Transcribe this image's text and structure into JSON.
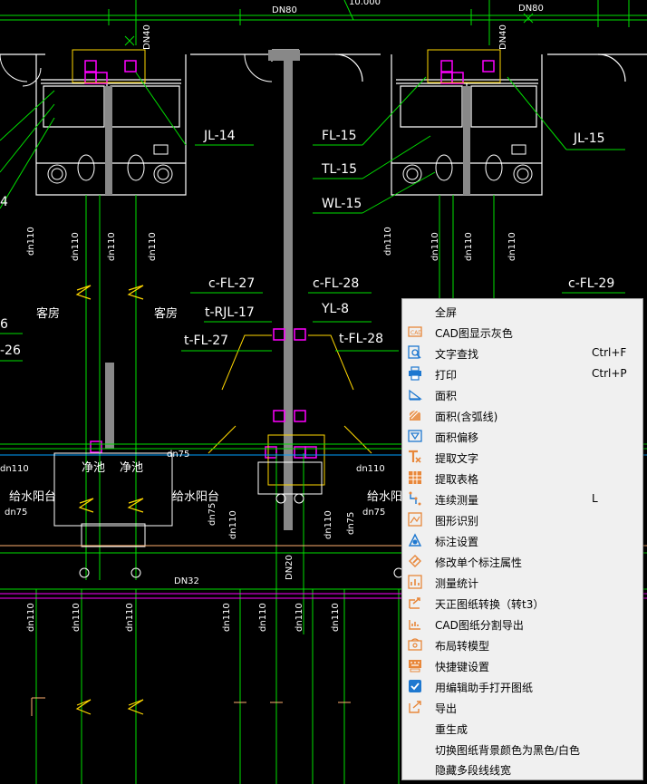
{
  "drawing": {
    "pipe_size_labels": {
      "dn80": "DN80",
      "dn40": "DN40",
      "dn110": "dn110",
      "dn75": "dn75",
      "dn32": "DN32",
      "dn20": "DN20"
    },
    "top_value": "10.000",
    "pipe_labels": {
      "jl14": "JL-14",
      "jl15": "JL-15",
      "fl15": "FL-15",
      "tl15": "TL-15",
      "wl15": "WL-15",
      "fl27": "c-FL-27",
      "fl28a": "c-FL-28",
      "fl29": "c-FL-29",
      "rjl17": "t-RJL-17",
      "yl8": "YL-8",
      "tfl27": "t-FL-27",
      "tfl28": "t-FL-28",
      "num6": "6",
      "num26": "-26",
      "num4": "4"
    },
    "room_labels": {
      "kefang": "客房",
      "jingchi": "净池",
      "shuitai": "给水阳台"
    },
    "colors": {
      "pipe_green": "#00e000",
      "wall_white": "#ffffff",
      "fixture_magenta": "#ff00ff",
      "pipe_yellow": "#ffd700",
      "pipe_orange": "#ffb070",
      "column_gray": "#888888"
    }
  },
  "context_menu": {
    "items": [
      {
        "label": "全屏",
        "shortcut": "",
        "icon": "none"
      },
      {
        "label": "CAD图显示灰色",
        "shortcut": "",
        "icon": "cad-gray-icon"
      },
      {
        "label": "文字查找",
        "shortcut": "Ctrl+F",
        "icon": "text-search-icon"
      },
      {
        "label": "打印",
        "shortcut": "Ctrl+P",
        "icon": "print-icon"
      },
      {
        "label": "面积",
        "shortcut": "",
        "icon": "area-icon"
      },
      {
        "label": "面积(含弧线)",
        "shortcut": "",
        "icon": "area-arc-icon"
      },
      {
        "label": "面积偏移",
        "shortcut": "",
        "icon": "area-offset-icon"
      },
      {
        "label": "提取文字",
        "shortcut": "",
        "icon": "extract-text-icon"
      },
      {
        "label": "提取表格",
        "shortcut": "",
        "icon": "extract-table-icon"
      },
      {
        "label": "连续测量",
        "shortcut": "L",
        "icon": "continuous-measure-icon"
      },
      {
        "label": "图形识别",
        "shortcut": "",
        "icon": "shape-recognize-icon"
      },
      {
        "label": "标注设置",
        "shortcut": "",
        "icon": "dimension-settings-icon"
      },
      {
        "label": "修改单个标注属性",
        "shortcut": "",
        "icon": "edit-dimension-icon"
      },
      {
        "label": "测量统计",
        "shortcut": "",
        "icon": "measure-stats-icon"
      },
      {
        "label": "天正图纸转换（转t3）",
        "shortcut": "",
        "icon": "tangent-convert-icon"
      },
      {
        "label": "CAD图纸分割导出",
        "shortcut": "",
        "icon": "split-export-icon"
      },
      {
        "label": "布局转模型",
        "shortcut": "",
        "icon": "layout-model-icon"
      },
      {
        "label": "快捷键设置",
        "shortcut": "",
        "icon": "keyboard-icon"
      },
      {
        "label": "用编辑助手打开图纸",
        "shortcut": "",
        "icon": "edit-assistant-icon"
      },
      {
        "label": "导出",
        "shortcut": "",
        "icon": "export-icon"
      },
      {
        "label": "重生成",
        "shortcut": "",
        "icon": "none"
      },
      {
        "label": "切换图纸背景颜色为黑色/白色",
        "shortcut": "",
        "icon": "none"
      },
      {
        "label": "隐藏多段线线宽",
        "shortcut": "",
        "icon": "none"
      }
    ],
    "colors": {
      "background": "#f0f0f0",
      "border": "#a0a0a0",
      "icon_orange": "#e8873a",
      "icon_blue": "#1e78d0"
    }
  }
}
